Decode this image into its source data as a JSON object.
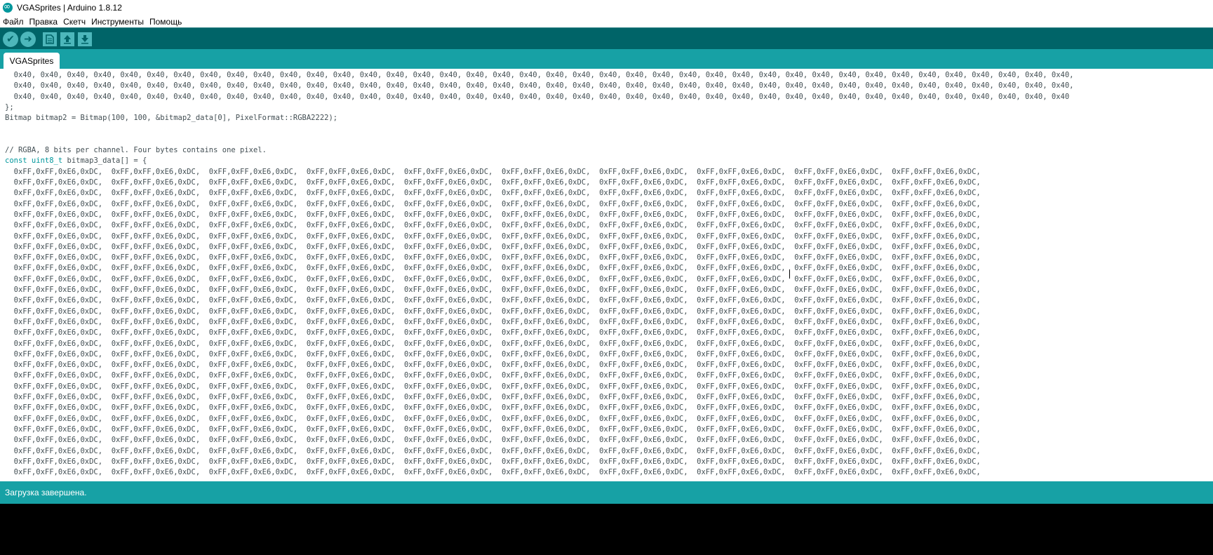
{
  "window": {
    "title": "VGASprites | Arduino 1.8.12"
  },
  "menu": {
    "items": [
      "Файл",
      "Правка",
      "Скетч",
      "Инструменты",
      "Помощь"
    ]
  },
  "toolbar": {
    "buttons": [
      {
        "name": "verify",
        "icon": "checkmark-icon"
      },
      {
        "name": "upload",
        "icon": "arrow-right-icon"
      },
      {
        "name": "new",
        "icon": "new-file-icon"
      },
      {
        "name": "open",
        "icon": "arrow-up-icon"
      },
      {
        "name": "save",
        "icon": "arrow-down-icon"
      }
    ]
  },
  "tabs": [
    {
      "label": "VGASprites"
    }
  ],
  "editor": {
    "top_lines": [
      "  0x40, 0x40, 0x40, 0x40, 0x40, 0x40, 0x40, 0x40, 0x40, 0x40, 0x40, 0x40, 0x40, 0x40, 0x40, 0x40, 0x40, 0x40, 0x40, 0x40, 0x40, 0x40, 0x40, 0x40, 0x40, 0x40, 0x40, 0x40, 0x40, 0x40, 0x40, 0x40, 0x40, 0x40, 0x40, 0x40, 0x40, 0x40, 0x40, 0x40,",
      "  0x40, 0x40, 0x40, 0x40, 0x40, 0x40, 0x40, 0x40, 0x40, 0x40, 0x40, 0x40, 0x40, 0x40, 0x40, 0x40, 0x40, 0x40, 0x40, 0x40, 0x40, 0x40, 0x40, 0x40, 0x40, 0x40, 0x40, 0x40, 0x40, 0x40, 0x40, 0x40, 0x40, 0x40, 0x40, 0x40, 0x40, 0x40, 0x40, 0x40,",
      "  0x40, 0x40, 0x40, 0x40, 0x40, 0x40, 0x40, 0x40, 0x40, 0x40, 0x40, 0x40, 0x40, 0x40, 0x40, 0x40, 0x40, 0x40, 0x40, 0x40, 0x40, 0x40, 0x40, 0x40, 0x40, 0x40, 0x40, 0x40, 0x40, 0x40, 0x40, 0x40, 0x40, 0x40, 0x40, 0x40, 0x40, 0x40, 0x40, 0x40",
      "};",
      "Bitmap bitmap2 = Bitmap(100, 100, &bitmap2_data[0], PixelFormat::RGBA2222);",
      "",
      "",
      "// RGBA, 8 bits per channel. Four bytes contains one pixel."
    ],
    "decl_keyword": "const uint8_t",
    "decl_rest": " bitmap3_data[] = {",
    "data_line": "  0xFF,0xFF,0xE6,0xDC,  0xFF,0xFF,0xE6,0xDC,  0xFF,0xFF,0xE6,0xDC,  0xFF,0xFF,0xE6,0xDC,  0xFF,0xFF,0xE6,0xDC,  0xFF,0xFF,0xE6,0xDC,  0xFF,0xFF,0xE6,0xDC,  0xFF,0xFF,0xE6,0xDC,  0xFF,0xFF,0xE6,0xDC,  0xFF,0xFF,0xE6,0xDC,",
    "data_line_count": 29
  },
  "status": {
    "message": "Загрузка завершена."
  },
  "colors": {
    "toolbar_bg": "#006468",
    "tab_bar_bg": "#17a1a5",
    "button_bg": "#4db7bb",
    "keyword": "#00979c",
    "code_text": "#434f54",
    "console_bg": "#000000"
  }
}
